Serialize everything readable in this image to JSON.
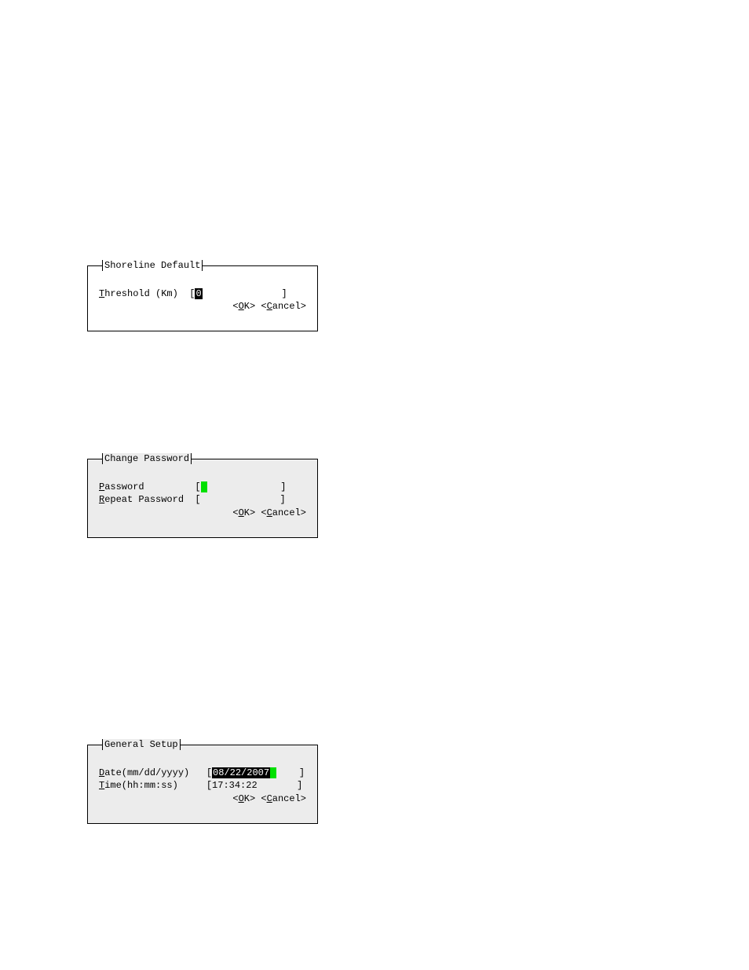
{
  "shoreline": {
    "title": "Shoreline Default",
    "label_hot": "T",
    "label_rest": "hreshold (Km)",
    "value": "0",
    "ok_hot": "O",
    "ok_rest": "K",
    "cancel_hot": "C",
    "cancel_rest": "ancel"
  },
  "changepw": {
    "title": "Change Password",
    "pw_hot": "P",
    "pw_rest": "assword",
    "rp_hot": "R",
    "rp_rest": "epeat Password",
    "ok_hot": "O",
    "ok_rest": "K",
    "cancel_hot": "C",
    "cancel_rest": "ancel"
  },
  "general": {
    "title": "General Setup",
    "date_hot": "D",
    "date_rest": "ate(mm/dd/yyyy)",
    "time_hot": "T",
    "time_rest": "ime(hh:mm:ss)",
    "date_value": "08/22/2007",
    "time_value": "17:34:22",
    "ok_hot": "O",
    "ok_rest": "K",
    "cancel_hot": "C",
    "cancel_rest": "ancel"
  }
}
